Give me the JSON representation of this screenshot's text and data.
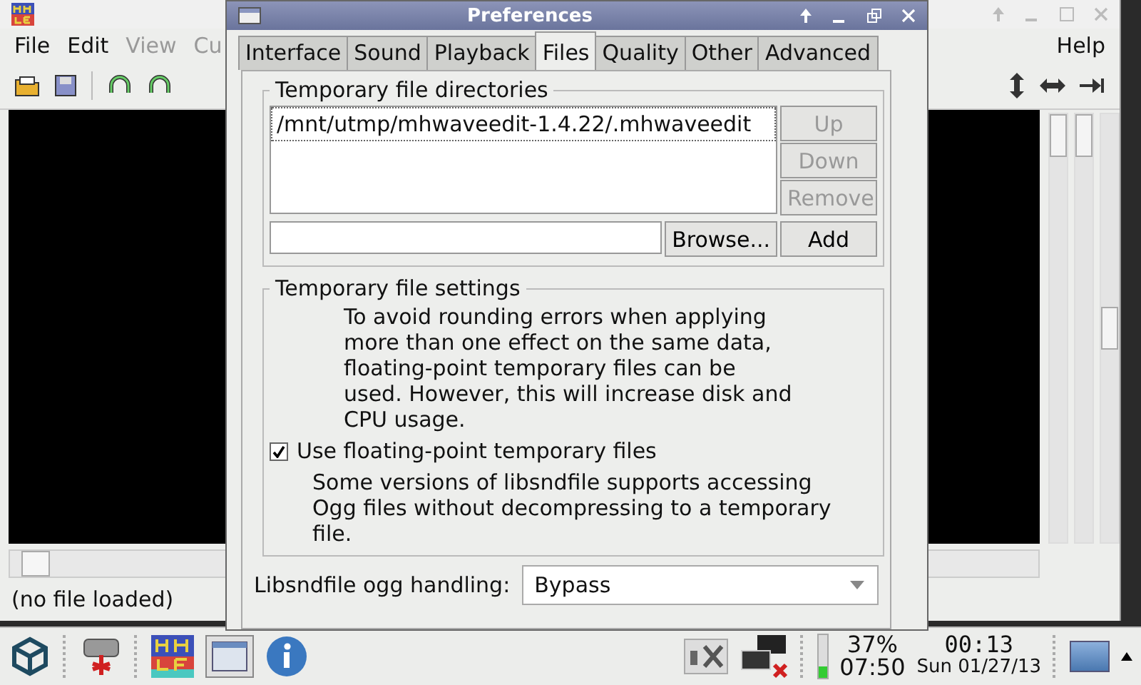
{
  "main_window": {
    "menu": [
      {
        "label": "File",
        "disabled": false
      },
      {
        "label": "Edit",
        "disabled": false
      },
      {
        "label": "View",
        "disabled": true
      },
      {
        "label": "Cu",
        "disabled": true
      }
    ],
    "help_menu": "Help",
    "sliders": [
      {
        "level": 0
      },
      {
        "level": 0
      },
      {
        "level": 0.5
      }
    ],
    "status": "(no file loaded)"
  },
  "dialog": {
    "title": "Preferences",
    "tabs": [
      {
        "label": "Interface",
        "selected": false
      },
      {
        "label": "Sound",
        "selected": false
      },
      {
        "label": "Playback",
        "selected": false
      },
      {
        "label": "Files",
        "selected": true
      },
      {
        "label": "Quality",
        "selected": false
      },
      {
        "label": "Other",
        "selected": false
      },
      {
        "label": "Advanced",
        "selected": false
      }
    ],
    "directories": {
      "title": "Temporary file directories",
      "items": [
        "/mnt/utmp/mhwaveedit-1.4.22/.mhwaveedit"
      ],
      "side_buttons": [
        {
          "label": "Up",
          "disabled": true
        },
        {
          "label": "Down",
          "disabled": true
        },
        {
          "label": "Remove",
          "disabled": true
        }
      ],
      "browse_button": "Browse...",
      "add_button": "Add"
    },
    "settings": {
      "title": "Temporary file settings",
      "description": "To avoid rounding errors when applying more than one effect on the same data, floating-point temporary files can be used. However, this will increase disk and CPU usage.",
      "checkbox": {
        "label": "Use floating-point temporary files",
        "checked": true
      },
      "note": "Some versions of libsndfile supports accessing Ogg files without decompressing to a temporary file.",
      "ogg_label": "Libsndfile ogg handling:",
      "ogg_value": "Bypass"
    }
  },
  "taskbar": {
    "battery_percent": "37%",
    "battery_time": "07:50",
    "time": "00:13",
    "date": "Sun 01/27/13"
  }
}
